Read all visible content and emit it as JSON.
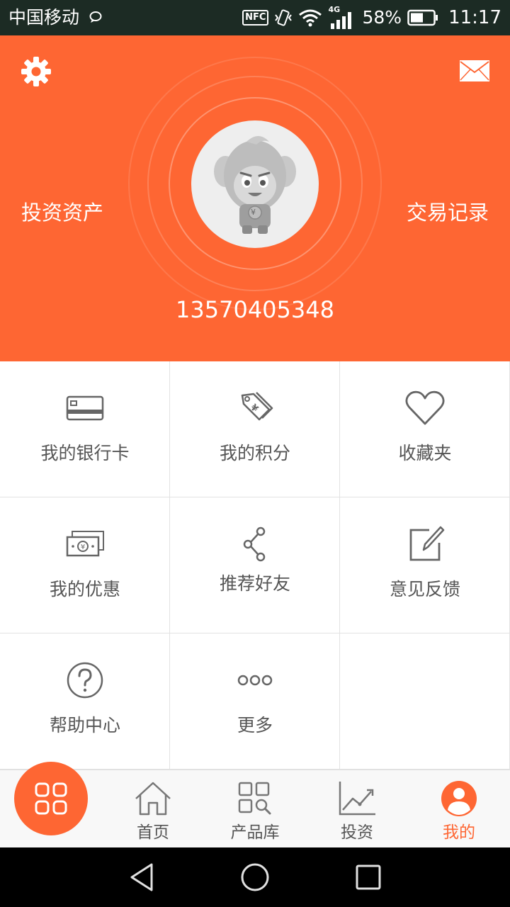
{
  "status_bar": {
    "carrier": "中国移动",
    "nfc": "NFC",
    "network": "4G",
    "battery": "58%",
    "time": "11:17"
  },
  "header": {
    "left_link": "投资资产",
    "right_link": "交易记录",
    "phone": "13570405348",
    "avatar_text": "¥"
  },
  "grid": {
    "items": [
      {
        "label": "我的银行卡",
        "icon": "bank-card-icon"
      },
      {
        "label": "我的积分",
        "icon": "points-tag-icon"
      },
      {
        "label": "收藏夹",
        "icon": "heart-icon"
      },
      {
        "label": "我的优惠",
        "icon": "coupon-cash-icon"
      },
      {
        "label": "推荐好友",
        "icon": "share-icon"
      },
      {
        "label": "意见反馈",
        "icon": "edit-icon"
      },
      {
        "label": "帮助中心",
        "icon": "help-icon"
      },
      {
        "label": "更多",
        "icon": "more-icon"
      }
    ]
  },
  "bottom_nav": {
    "tabs": [
      {
        "label": "首页",
        "icon": "home-icon"
      },
      {
        "label": "产品库",
        "icon": "product-search-icon"
      },
      {
        "label": "投资",
        "icon": "chart-icon"
      },
      {
        "label": "我的",
        "icon": "user-icon"
      }
    ],
    "active_index": 3
  },
  "colors": {
    "accent": "#fe6633",
    "status_bar": "#1c2b24",
    "icon_gray": "#666666",
    "text_gray": "#555555"
  }
}
